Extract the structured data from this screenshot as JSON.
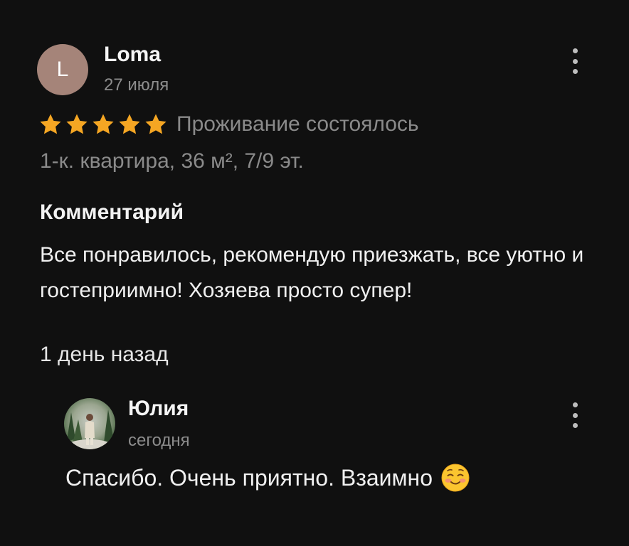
{
  "review": {
    "author": {
      "initial": "L",
      "name": "Loma",
      "date": "27 июля"
    },
    "rating": {
      "stars": 5,
      "max": 5,
      "color": "#f5a623"
    },
    "stay_status": "Проживание состоялось",
    "apartment": "1-к. квартира, 36 м², 7/9 эт.",
    "comment_title": "Комментарий",
    "comment_text": "Все понравилось, рекомендую приезжать, все уютно и гостеприимно! Хозяева просто супер!",
    "time_ago": "1 день назад",
    "menu_icon": "more-vertical-icon"
  },
  "reply": {
    "author": {
      "name": "Юлия",
      "date": "сегодня"
    },
    "text": "Спасибо. Очень приятно. Взаимно",
    "emoji": "smiling-face-with-blush-emoji",
    "menu_icon": "more-vertical-icon"
  },
  "colors": {
    "background": "#101010",
    "avatar": "#a58479",
    "muted_text": "#8a8a8a",
    "star": "#f5a623"
  }
}
